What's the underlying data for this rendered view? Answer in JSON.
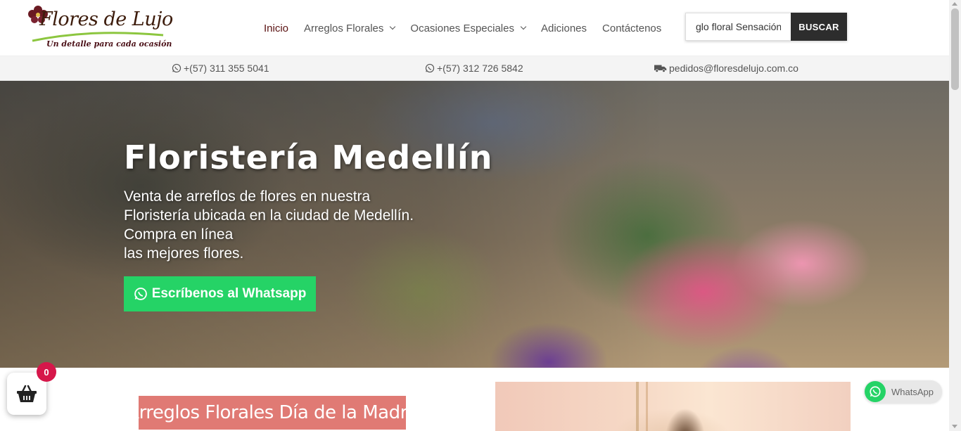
{
  "header": {
    "logo": {
      "name": "Flores de Lujo",
      "tagline": "Un detalle para cada ocasión"
    },
    "nav": [
      {
        "label": "Inicio",
        "active": true,
        "dropdown": false
      },
      {
        "label": "Arreglos Florales",
        "active": false,
        "dropdown": true
      },
      {
        "label": "Ocasiones Especiales",
        "active": false,
        "dropdown": true
      },
      {
        "label": "Adiciones",
        "active": false,
        "dropdown": false
      },
      {
        "label": "Contáctenos",
        "active": false,
        "dropdown": false
      }
    ],
    "search": {
      "value": "glo floral Sensación-",
      "button_label": "BUSCAR"
    }
  },
  "contact_bar": {
    "phone1": "+(57) 311 355 5041",
    "phone2": "+(57) 312 726 5842",
    "email": "pedidos@floresdelujo.com.co"
  },
  "hero": {
    "title": "Floristería Medellín",
    "lines": [
      "Venta de arreflos de flores en nuestra",
      "Floristería  ubicada en la ciudad de Medellín.",
      "Compra en línea",
      "las mejores flores."
    ],
    "cta_label": "Escríbenos al Whatsapp"
  },
  "section": {
    "title": "Arreglos Florales Día de la Madre"
  },
  "cart": {
    "count": "0"
  },
  "whatsapp_chat": {
    "label": "WhatsApp"
  },
  "colors": {
    "brand_dark": "#5a1212",
    "whatsapp_green": "#25d366",
    "section_title_bg": "#e07a74",
    "badge_red": "#d6174a",
    "search_button": "#2d2d2d"
  },
  "icons": [
    "whatsapp-icon",
    "truck-icon",
    "basket-icon",
    "chevron-down-icon",
    "flower-logo-icon"
  ]
}
